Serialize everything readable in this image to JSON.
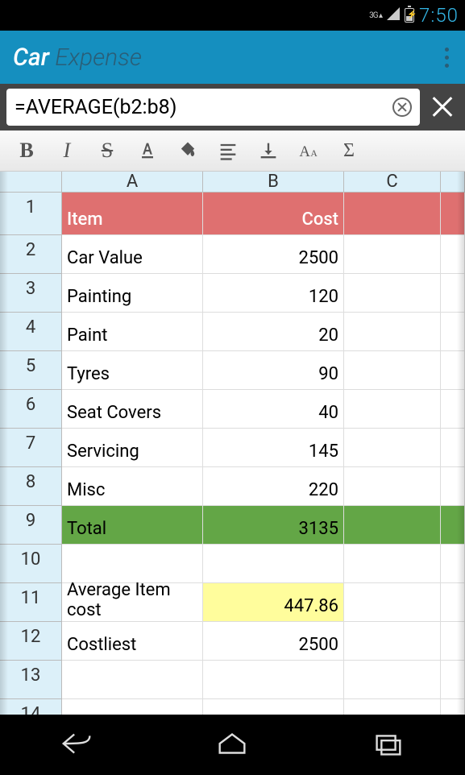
{
  "status": {
    "network": "3G",
    "time": "7:50"
  },
  "app": {
    "title1": "Car",
    "title2": "Expense"
  },
  "formula": {
    "text": "=AVERAGE(b2:b8)"
  },
  "columns": [
    "A",
    "B",
    "C"
  ],
  "rows": [
    {
      "n": "1",
      "a": "Item",
      "b": "Cost",
      "style": "header"
    },
    {
      "n": "2",
      "a": "Car Value",
      "b": "2500"
    },
    {
      "n": "3",
      "a": "Painting",
      "b": "120"
    },
    {
      "n": "4",
      "a": "Paint",
      "b": "20"
    },
    {
      "n": "5",
      "a": "Tyres",
      "b": "90"
    },
    {
      "n": "6",
      "a": "Seat Covers",
      "b": "40"
    },
    {
      "n": "7",
      "a": "Servicing",
      "b": "145"
    },
    {
      "n": "8",
      "a": "Misc",
      "b": "220"
    },
    {
      "n": "9",
      "a": "Total",
      "b": "3135",
      "style": "total"
    },
    {
      "n": "10",
      "a": "",
      "b": ""
    },
    {
      "n": "11",
      "a": "Average Item cost",
      "b": "447.86",
      "bstyle": "highlight"
    },
    {
      "n": "12",
      "a": "Costliest",
      "b": "2500"
    },
    {
      "n": "13",
      "a": "",
      "b": ""
    },
    {
      "n": "14",
      "a": "",
      "b": ""
    }
  ]
}
